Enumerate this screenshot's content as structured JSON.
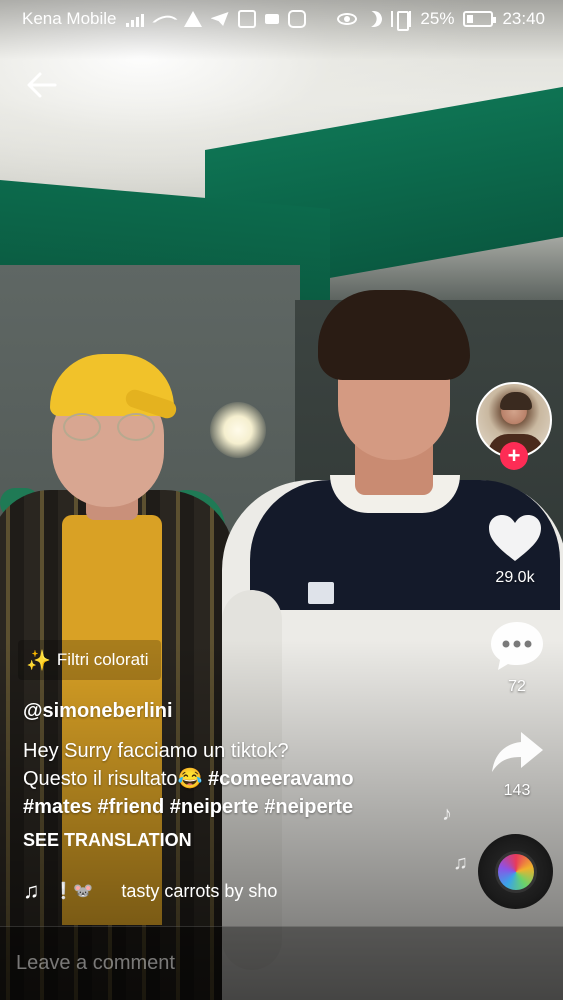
{
  "status_bar": {
    "carrier": "Kena Mobile",
    "battery_percent": "25%",
    "battery_level": 0.25,
    "time": "23:40",
    "left_icons": [
      "signal-icon",
      "wifi-icon",
      "warning-icon",
      "telegram-icon",
      "app-notification-icon",
      "chat-icon",
      "instagram-icon"
    ],
    "right_icons": [
      "eye-icon",
      "moon-icon",
      "vibrate-icon",
      "battery-icon"
    ]
  },
  "nav": {
    "back_icon": "back-arrow-icon"
  },
  "effect": {
    "icon": "magic-wand-icon",
    "label": "Filtri colorati"
  },
  "post": {
    "username": "@simoneberlini",
    "caption_line1": "Hey Surry facciamo un tiktok?",
    "caption_line2_text": "Questo il risultato😂",
    "hashtags_line2": [
      "#comeeravamo"
    ],
    "hashtags_line3": [
      "#mates",
      "#friend",
      "#neiperte",
      "#neiperte"
    ],
    "see_translation": "SEE TRANSLATION"
  },
  "sound": {
    "icon": "music-note-icon",
    "decor": "❕🐭",
    "name": "tasty carrots by sho"
  },
  "actions": {
    "follow_symbol": "+",
    "likes": "29.0k",
    "comments": "72",
    "shares": "143"
  },
  "comment": {
    "placeholder": "Leave a comment"
  },
  "colors": {
    "accent": "#fe2c55",
    "effect_wand": "#f7c548"
  }
}
